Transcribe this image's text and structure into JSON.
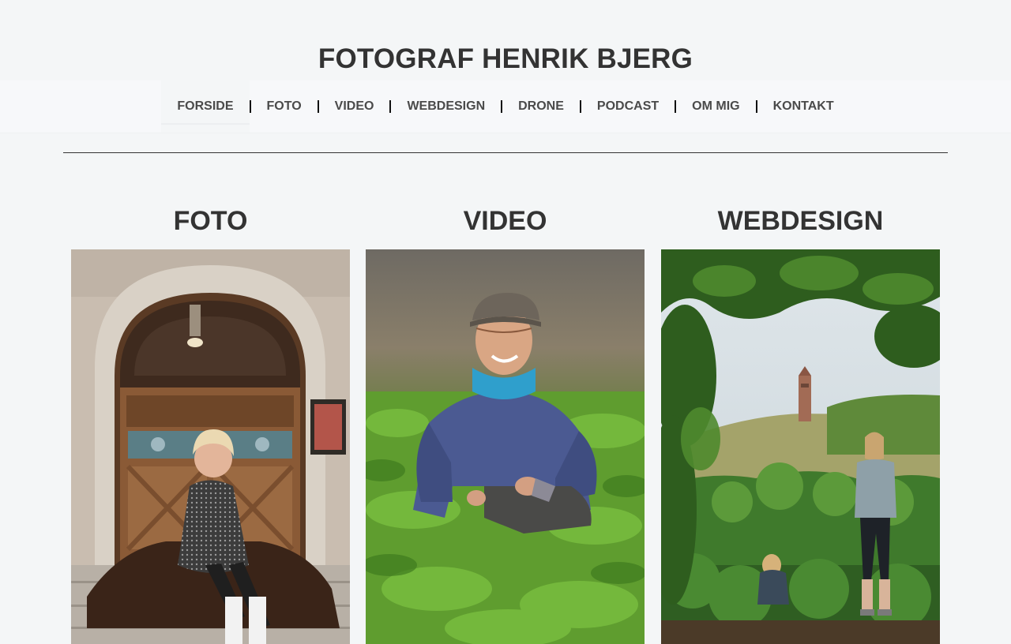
{
  "site": {
    "title": "FOTOGRAF HENRIK BJERG"
  },
  "nav": {
    "items": [
      {
        "label": "FORSIDE",
        "active": true
      },
      {
        "label": "FOTO"
      },
      {
        "label": "VIDEO"
      },
      {
        "label": "WEBDESIGN"
      },
      {
        "label": "DRONE"
      },
      {
        "label": "PODCAST"
      },
      {
        "label": "OM MIG"
      },
      {
        "label": "KONTAKT"
      }
    ]
  },
  "sections": [
    {
      "title": "FOTO"
    },
    {
      "title": "VIDEO"
    },
    {
      "title": "WEBDESIGN"
    }
  ]
}
